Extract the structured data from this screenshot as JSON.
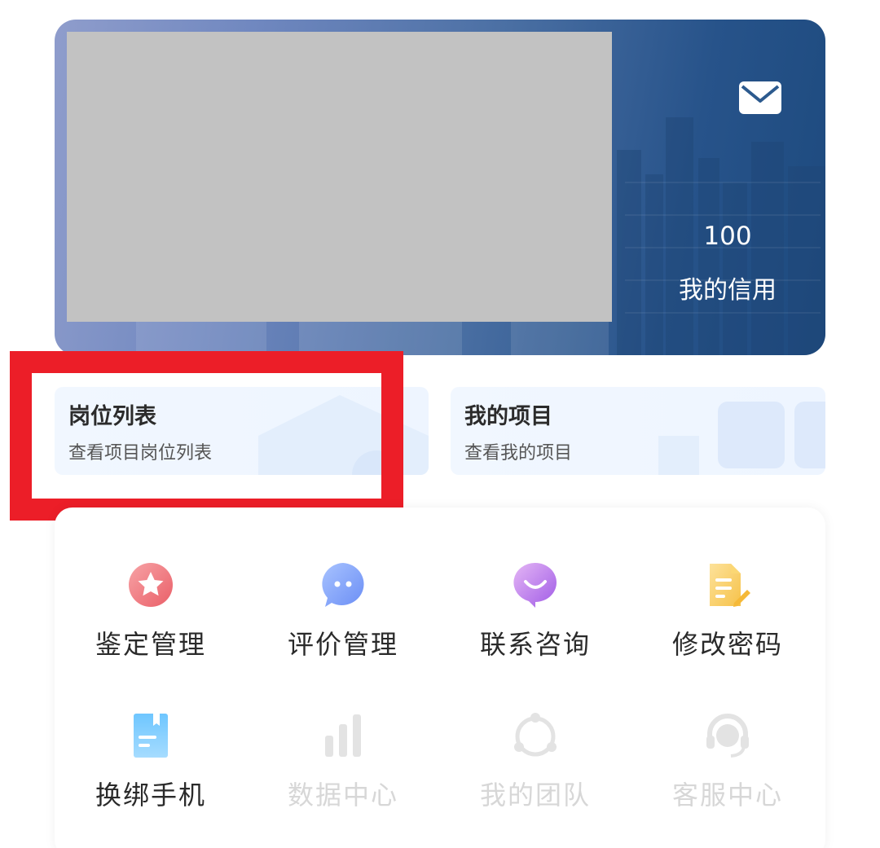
{
  "header": {
    "credit_value": "100",
    "credit_label": "我的信用"
  },
  "quick_links": [
    {
      "title": "岗位列表",
      "subtitle": "查看项目岗位列表"
    },
    {
      "title": "我的项目",
      "subtitle": "查看我的项目"
    }
  ],
  "menu": [
    {
      "label": "鉴定管理",
      "icon": "star-badge-icon",
      "enabled": true
    },
    {
      "label": "评价管理",
      "icon": "chat-bubble-icon",
      "enabled": true
    },
    {
      "label": "联系咨询",
      "icon": "smile-bubble-icon",
      "enabled": true
    },
    {
      "label": "修改密码",
      "icon": "edit-document-icon",
      "enabled": true
    },
    {
      "label": "换绑手机",
      "icon": "phone-card-icon",
      "enabled": true
    },
    {
      "label": "数据中心",
      "icon": "bar-chart-icon",
      "enabled": false
    },
    {
      "label": "我的团队",
      "icon": "team-circle-icon",
      "enabled": false
    },
    {
      "label": "客服中心",
      "icon": "headset-icon",
      "enabled": false
    }
  ],
  "colors": {
    "highlight": "#ec1e28",
    "header_gradient_start": "#8f9dcc",
    "header_gradient_end": "#1d4a7e",
    "menu_label": "#2a2a2a",
    "menu_label_disabled": "#d7d7d7"
  }
}
